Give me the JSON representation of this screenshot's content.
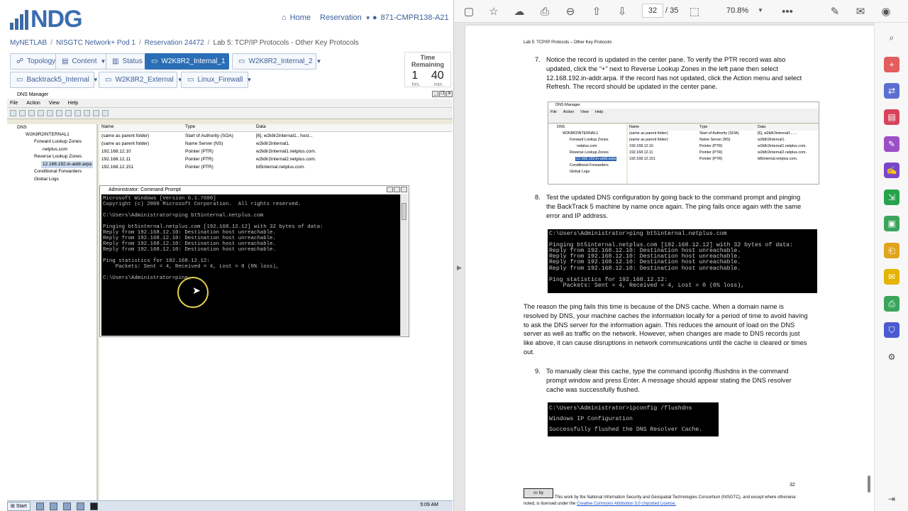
{
  "portal": {
    "logo_text": "NDG",
    "nav": {
      "home": "Home",
      "reservation": "Reservation",
      "pod_id": "871-CMPR138-A21"
    },
    "breadcrumb": [
      "MyNETLAB",
      "NISGTC Network+ Pod 1",
      "Reservation 24472",
      "Lab 5: TCP/IP Protocols - Other Key Protocols"
    ],
    "tabs_row1": {
      "topology": "Topology",
      "content": "Content",
      "status": "Status",
      "vm1": "W2K8R2_Internal_1",
      "vm2": "W2K8R2_Internal_2"
    },
    "tabs_row2": {
      "vm3": "Backtrack5_Internal",
      "vm4": "W2K8R2_External",
      "vm5": "Linux_Firewall"
    },
    "time_remaining": {
      "label": "Time Remaining",
      "hours": "1",
      "minutes": "40",
      "hours_unit": "hrs.",
      "minutes_unit": "min."
    }
  },
  "dns_manager": {
    "title": "DNS Manager",
    "menu": [
      "File",
      "Action",
      "View",
      "Help"
    ],
    "tree": {
      "root": "DNS",
      "server": "W2K8R2INTERNAL1",
      "forward": "Forward Lookup Zones",
      "forward_zone": "netplus.com",
      "reverse": "Reverse Lookup Zones",
      "reverse_zone": "12.168.192.in-addr.arpa",
      "conditional": "Conditional Forwarders",
      "global": "Global Logs"
    },
    "columns": [
      "Name",
      "Type",
      "Data"
    ],
    "rows": [
      {
        "name": "(same as parent folder)",
        "type": "Start of Authority (SOA)",
        "data": "[6], w2k8r2internal1., host..."
      },
      {
        "name": "(same as parent folder)",
        "type": "Name Server (NS)",
        "data": "w2k8r2internal1."
      },
      {
        "name": "192.168.12.10",
        "type": "Pointer (PTR)",
        "data": "w2k8r2internal1.netplus.com."
      },
      {
        "name": "192.168.12.11",
        "type": "Pointer (PTR)",
        "data": "w2k8r2internal2.netplus.com."
      },
      {
        "name": "192.168.12.151",
        "type": "Pointer (PTR)",
        "data": "bt5internal.netplus.com."
      }
    ]
  },
  "cmd": {
    "title": "Administrator: Command Prompt",
    "output": "Microsoft Windows [Version 6.1.7600]\nCopyright (c) 2009 Microsoft Corporation.  All rights reserved.\n\nC:\\Users\\Administrator>ping bt5internal.netplus.com\n\nPinging bt5internal.netplus.com [192.168.12.12] with 32 bytes of data:\nReply from 192.168.12.10: Destination host unreachable.\nReply from 192.168.12.10: Destination host unreachable.\nReply from 192.168.12.10: Destination host unreachable.\nReply from 192.168.12.10: Destination host unreachable.\n\nPing statistics for 192.168.12.12:\n    Packets: Sent = 4, Received = 4, Lost = 0 (0% loss),\n\nC:\\Users\\Administrator>ping_"
  },
  "taskbar": {
    "start": "Start",
    "clock": "5:09 AM"
  },
  "pdf": {
    "current_page": "32",
    "total_pages": "/ 35",
    "zoom": "70.8%",
    "doc": {
      "header": "Lab 5:  TCP/IP Protocols – Other Key Protocols",
      "step7_num": "7.",
      "step7": "Notice the record is updated in the center pane.  To verify the PTR record was also updated, click the “+” next to Reverse Lookup Zones in the left pane then select 12.168.192.in-addr.arpa.  If the record has not updated, click the Action menu and select Refresh.  The record should be updated in the center pane.",
      "step8_num": "8.",
      "step8": "Test the updated DNS configuration by going back to the command prompt and pinging the BackTrack 5 machine by name once again.  The ping fails once again with the same error and IP address.",
      "para_cache": "The reason the ping fails this time is because of the DNS cache.  When a domain name is resolved by DNS, your machine caches the information locally for a period of time to avoid having to ask the DNS server for the information again.  This reduces the amount of load on the DNS server as well as traffic on the network.  However, when changes are made to DNS records just like above, it can cause disruptions in network communications until the cache is cleared or times out.",
      "step9_num": "9.",
      "step9": "To manually clear this cache, type the command ipconfig /flushdns in the command prompt window and press Enter.  A message should appear stating the DNS resolver cache was successfully flushed.",
      "shot_dns": {
        "title": "DNS Manager",
        "menu": [
          "File",
          "Action",
          "View",
          "Help"
        ],
        "tree": [
          "DNS",
          "W2K8R2INTERNAL1",
          "Forward Lookup Zones",
          "netplus.com",
          "Reverse Lookup Zones",
          "12.168.192.in-addr.arpa",
          "Conditional Forwarders",
          "Global Logs"
        ],
        "columns": [
          "Name",
          "Type",
          "Data"
        ],
        "rows": [
          [
            "(same as parent folder)",
            "Start of Authority (SOA)",
            "[6], w2k8r2internal1., ..."
          ],
          [
            "(same as parent folder)",
            "Name Server (NS)",
            "w2k8r2internal1."
          ],
          [
            "192.168.12.10",
            "Pointer (PTR)",
            "w2k8r2internal1.netplus.com."
          ],
          [
            "192.168.12.11",
            "Pointer (PTR)",
            "w2k8r2internal2.netplus.com."
          ],
          [
            "192.168.12.151",
            "Pointer (PTR)",
            "bt5internal.netplus.com."
          ]
        ]
      },
      "shot_cmd1": "C:\\Users\\Administrator>ping bt5internal.netplus.com\n\nPinging bt5internal.netplus.com [192.168.12.12] with 32 bytes of data:\nReply from 192.168.12.10: Destination host unreachable.\nReply from 192.168.12.10: Destination host unreachable.\nReply from 192.168.12.10: Destination host unreachable.\nReply from 192.168.12.10: Destination host unreachable.\n\nPing statistics for 192.168.12.12:\n    Packets: Sent = 4, Received = 4, Lost = 0 (0% loss),",
      "shot_cmd2": "C:\\Users\\Administrator>ipconfig /flushdns\nWindows IP Configuration\nSuccessfully flushed the DNS Resolver Cache.",
      "page_number": "32",
      "cc_badge": "cc by",
      "footer": "This work by the National Information Security and Geospatial Technologies Consortium (NISGTC), and except where otherwise noted, is licensed under the ",
      "footer_link": "Creative Commons Attribution 3.0 Unported License."
    }
  }
}
